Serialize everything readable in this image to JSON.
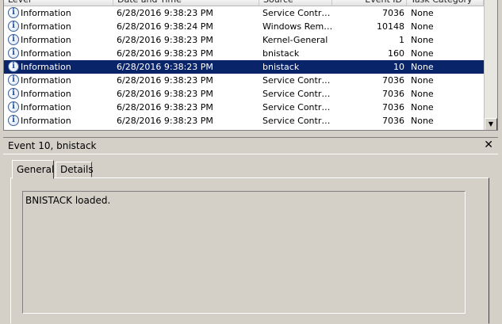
{
  "grid": {
    "columns": [
      "Level",
      "Date and Time",
      "Source",
      "Event ID",
      "Task Category"
    ],
    "rows": [
      {
        "level": "Information",
        "date": "6/28/2016 9:38:23 PM",
        "source": "Service Contr…",
        "event_id": "7036",
        "task": "None"
      },
      {
        "level": "Information",
        "date": "6/28/2016 9:38:24 PM",
        "source": "Windows Rem…",
        "event_id": "10148",
        "task": "None"
      },
      {
        "level": "Information",
        "date": "6/28/2016 9:38:23 PM",
        "source": "Kernel-General",
        "event_id": "1",
        "task": "None"
      },
      {
        "level": "Information",
        "date": "6/28/2016 9:38:23 PM",
        "source": "bnistack",
        "event_id": "160",
        "task": "None"
      },
      {
        "level": "Information",
        "date": "6/28/2016 9:38:23 PM",
        "source": "bnistack",
        "event_id": "10",
        "task": "None",
        "selected": true
      },
      {
        "level": "Information",
        "date": "6/28/2016 9:38:23 PM",
        "source": "Service Contr…",
        "event_id": "7036",
        "task": "None"
      },
      {
        "level": "Information",
        "date": "6/28/2016 9:38:23 PM",
        "source": "Service Contr…",
        "event_id": "7036",
        "task": "None"
      },
      {
        "level": "Information",
        "date": "6/28/2016 9:38:23 PM",
        "source": "Service Contr…",
        "event_id": "7036",
        "task": "None"
      },
      {
        "level": "Information",
        "date": "6/28/2016 9:38:23 PM",
        "source": "Service Contr…",
        "event_id": "7036",
        "task": "None"
      }
    ],
    "icon": "information-icon",
    "selected_color": "#0a246a"
  },
  "detail": {
    "title": "Event 10, bnistack",
    "close_glyph": "✕",
    "tabs": [
      {
        "label": "General",
        "active": true
      },
      {
        "label": "Details",
        "active": false
      }
    ],
    "message": "BNISTACK loaded."
  },
  "scrollbar": {
    "down_glyph": "▼"
  }
}
